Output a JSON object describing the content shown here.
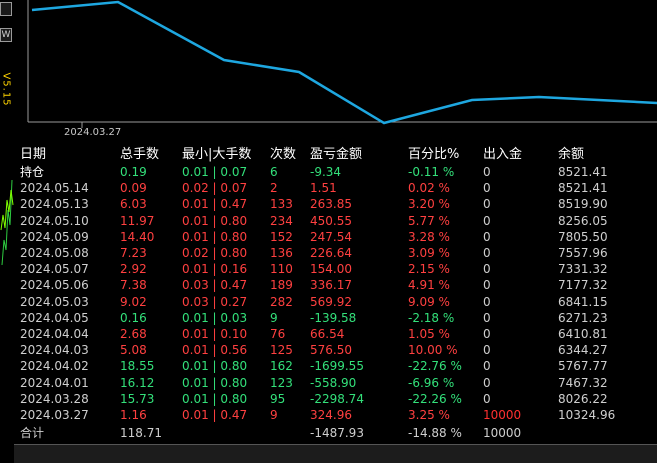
{
  "sidebar": {
    "version": "V5.15",
    "btn_top": "",
    "btn_w": "W"
  },
  "chart": {
    "x_tick_label": "2024.03.27",
    "line_color": "#1ea7e0"
  },
  "table": {
    "headers": {
      "date": "日期",
      "total_lots": "总手数",
      "min_max_lots": "最小|大手数",
      "count": "次数",
      "profit": "盈亏金额",
      "percent": "百分比%",
      "flow": "出入金",
      "balance": "余额"
    },
    "rows": [
      {
        "date": "持仓",
        "total": "0.19",
        "minmax": "0.01 | 0.07",
        "count": "6",
        "profit": "-9.34",
        "pct": "-0.11 %",
        "flow": "0",
        "balance": "8521.41",
        "sign": "minus",
        "bright": true
      },
      {
        "date": "2024.05.14",
        "total": "0.09",
        "minmax": "0.02 | 0.07",
        "count": "2",
        "profit": "1.51",
        "pct": "0.02 %",
        "flow": "0",
        "balance": "8521.41",
        "sign": "plus"
      },
      {
        "date": "2024.05.13",
        "total": "6.03",
        "minmax": "0.01 | 0.47",
        "count": "133",
        "profit": "263.85",
        "pct": "3.20 %",
        "flow": "0",
        "balance": "8519.90",
        "sign": "plus"
      },
      {
        "date": "2024.05.10",
        "total": "11.97",
        "minmax": "0.01 | 0.80",
        "count": "234",
        "profit": "450.55",
        "pct": "5.77 %",
        "flow": "0",
        "balance": "8256.05",
        "sign": "plus"
      },
      {
        "date": "2024.05.09",
        "total": "14.40",
        "minmax": "0.01 | 0.80",
        "count": "152",
        "profit": "247.54",
        "pct": "3.28 %",
        "flow": "0",
        "balance": "7805.50",
        "sign": "plus"
      },
      {
        "date": "2024.05.08",
        "total": "7.23",
        "minmax": "0.02 | 0.80",
        "count": "136",
        "profit": "226.64",
        "pct": "3.09 %",
        "flow": "0",
        "balance": "7557.96",
        "sign": "plus"
      },
      {
        "date": "2024.05.07",
        "total": "2.92",
        "minmax": "0.01 | 0.16",
        "count": "110",
        "profit": "154.00",
        "pct": "2.15 %",
        "flow": "0",
        "balance": "7331.32",
        "sign": "plus"
      },
      {
        "date": "2024.05.06",
        "total": "7.38",
        "minmax": "0.03 | 0.47",
        "count": "189",
        "profit": "336.17",
        "pct": "4.91 %",
        "flow": "0",
        "balance": "7177.32",
        "sign": "plus"
      },
      {
        "date": "2024.05.03",
        "total": "9.02",
        "minmax": "0.03 | 0.27",
        "count": "282",
        "profit": "569.92",
        "pct": "9.09 %",
        "flow": "0",
        "balance": "6841.15",
        "sign": "plus"
      },
      {
        "date": "2024.04.05",
        "total": "0.16",
        "minmax": "0.01 | 0.03",
        "count": "9",
        "profit": "-139.58",
        "pct": "-2.18 %",
        "flow": "0",
        "balance": "6271.23",
        "sign": "minus"
      },
      {
        "date": "2024.04.04",
        "total": "2.68",
        "minmax": "0.01 | 0.10",
        "count": "76",
        "profit": "66.54",
        "pct": "1.05 %",
        "flow": "0",
        "balance": "6410.81",
        "sign": "plus"
      },
      {
        "date": "2024.04.03",
        "total": "5.08",
        "minmax": "0.01 | 0.56",
        "count": "125",
        "profit": "576.50",
        "pct": "10.00 %",
        "flow": "0",
        "balance": "6344.27",
        "sign": "plus"
      },
      {
        "date": "2024.04.02",
        "total": "18.55",
        "minmax": "0.01 | 0.80",
        "count": "162",
        "profit": "-1699.55",
        "pct": "-22.76 %",
        "flow": "0",
        "balance": "5767.77",
        "sign": "minus"
      },
      {
        "date": "2024.04.01",
        "total": "16.12",
        "minmax": "0.01 | 0.80",
        "count": "123",
        "profit": "-558.90",
        "pct": "-6.96 %",
        "flow": "0",
        "balance": "7467.32",
        "sign": "minus"
      },
      {
        "date": "2024.03.28",
        "total": "15.73",
        "minmax": "0.01 | 0.80",
        "count": "95",
        "profit": "-2298.74",
        "pct": "-22.26 %",
        "flow": "0",
        "balance": "8026.22",
        "sign": "minus"
      },
      {
        "date": "2024.03.27",
        "total": "1.16",
        "minmax": "0.01 | 0.47",
        "count": "9",
        "profit": "324.96",
        "pct": "3.25 %",
        "flow": "10000",
        "balance": "10324.96",
        "sign": "plus",
        "flow_hl": true
      }
    ],
    "total": {
      "label": "合计",
      "total": "118.71",
      "profit": "-1487.93",
      "pct": "-14.88 %",
      "flow": "10000"
    }
  }
}
